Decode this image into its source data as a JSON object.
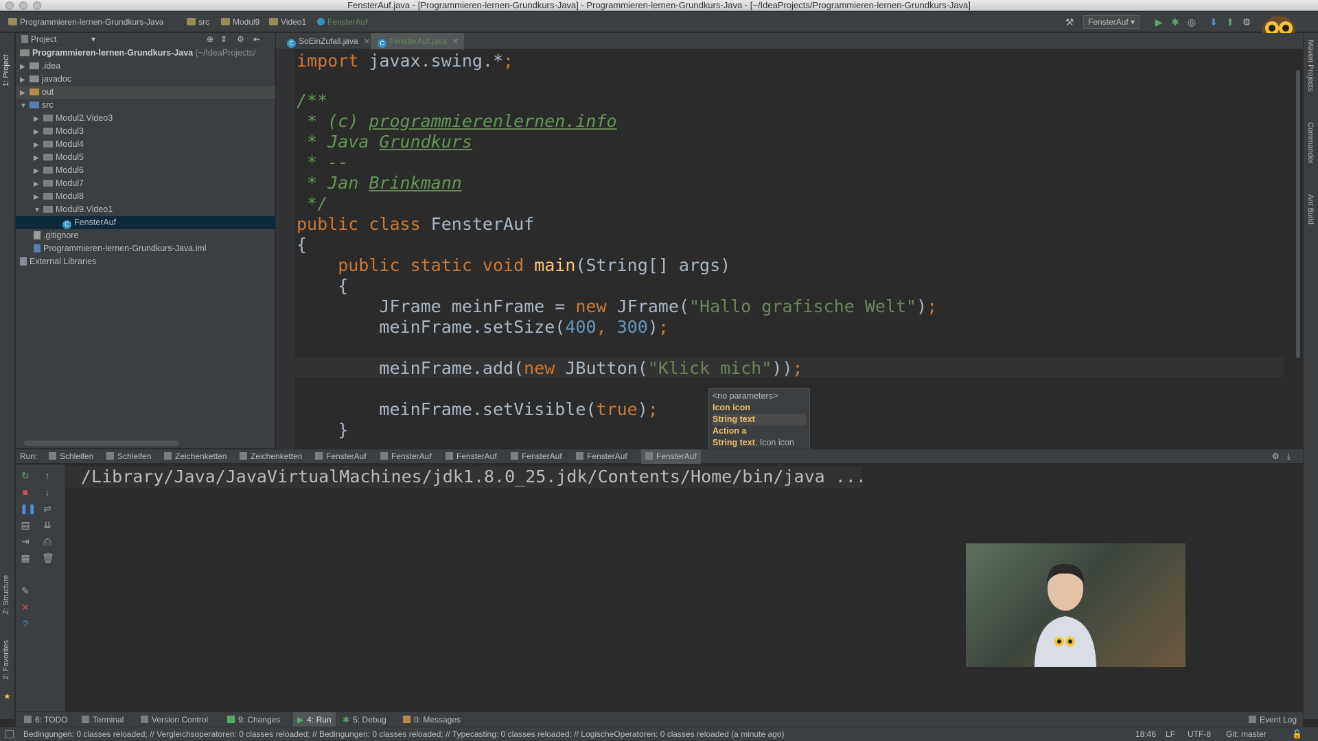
{
  "window": {
    "title": "FensterAuf.java - [Programmieren-lernen-Grundkurs-Java] - Programmieren-lernen-Grundkurs-Java - [~/IdeaProjects/Programmieren-lernen-Grundkurs-Java]"
  },
  "navbar": {
    "crumbs": [
      "Programmieren-lernen-Grundkurs-Java",
      "src",
      "Modul9",
      "Video1",
      "FensterAuf"
    ],
    "run_config": "FensterAuf"
  },
  "left_strip": {
    "project_tab": "1: Project",
    "structure_tab": "Z: Structure",
    "favorites_tab": "2: Favorites"
  },
  "right_strip": {
    "maven": "Maven Projects",
    "commander": "Commander",
    "ant": "Ant Build"
  },
  "project": {
    "view_label": "Project",
    "root_name": "Programmieren-lernen-Grundkurs-Java",
    "root_path": "(~/IdeaProjects/",
    "items": [
      ".idea",
      "javadoc",
      "out",
      "src",
      "Modul2.Video3",
      "Modul3",
      "Modul4",
      "Modul5",
      "Modul6",
      "Modul7",
      "Modul8",
      "Modul9.Video1",
      "FensterAuf",
      ".gitignore",
      "Programmieren-lernen-Grundkurs-Java.iml",
      "External Libraries"
    ]
  },
  "editor_tabs": [
    "SoEinZufall.java",
    "FensterAuf.java"
  ],
  "code": {
    "import_kw": "import",
    "import_rest": " javax.swing.*",
    "semi": ";",
    "c_open": "/**",
    "c_line1": " * (c) ",
    "c_link": "programmierenlernen.info",
    "c_line2": " * Java ",
    "c_grund": "Grundkurs",
    "c_line3": " * --",
    "c_line4": " * Jan ",
    "c_name": "Brinkmann",
    "c_close": " */",
    "public_class": "public class ",
    "class_name": "FensterAuf",
    "brace_open": "{",
    "psv": "    public static void ",
    "main_fn": "main",
    "main_args": "(String[] args)",
    "inner_open": "    {",
    "jf_a": "        JFrame meinFrame = ",
    "new_kw": "new",
    "jf_b": " JFrame(",
    "jf_str": "\"Hallo grafische Welt\"",
    "jf_c": ")",
    "ss_a": "        meinFrame.setSize(",
    "ss_n1": "400",
    "ss_comma": ", ",
    "ss_n2": "300",
    "ss_c": ")",
    "add_a": "        meinFrame.add(",
    "add_b": " JButton(",
    "add_str": "\"Klick mich\"",
    "add_c": "))",
    "sv_a": "        meinFrame.setVisible(",
    "sv_true": "true",
    "sv_c": ")",
    "inner_close": "    }",
    "outer_close": "}"
  },
  "param_popup": {
    "no_params": "<no parameters>",
    "icon": "Icon icon",
    "string": "String text",
    "action": "Action a",
    "string_icon_bold": "String text",
    "string_icon_rest": ", Icon icon"
  },
  "run_bar": {
    "label": "Run:",
    "tabs": [
      "Schleifen",
      "Schleifen",
      "Zeichenketten",
      "Zeichenketten",
      "FensterAuf",
      "FensterAuf",
      "FensterAuf",
      "FensterAuf",
      "FensterAuf",
      "FensterAuf"
    ]
  },
  "console": {
    "line": "/Library/Java/JavaVirtualMachines/jdk1.8.0_25.jdk/Contents/Home/bin/java ..."
  },
  "bottom_tabs": {
    "todo": "6: TODO",
    "terminal": "Terminal",
    "vcs": "Version Control",
    "changes": "9: Changes",
    "run": "4: Run",
    "debug": "5: Debug",
    "messages": "0: Messages",
    "event_log": "Event Log"
  },
  "status": {
    "message": "Bedingungen: 0 classes reloaded; // Vergleichsoperatoren: 0 classes reloaded; // Bedingungen: 0 classes reloaded; // Typecasting: 0 classes reloaded; // LogischeOperatoren: 0 classes reloaded (a minute ago)",
    "position": "18:46",
    "line_sep": "LF",
    "encoding": "UTF-8",
    "git": "Git: master"
  },
  "colors": {
    "keyword": "#cc7832",
    "string": "#6a8759",
    "number": "#6897bb",
    "function": "#ffc66d",
    "selection": "#0d293e"
  }
}
